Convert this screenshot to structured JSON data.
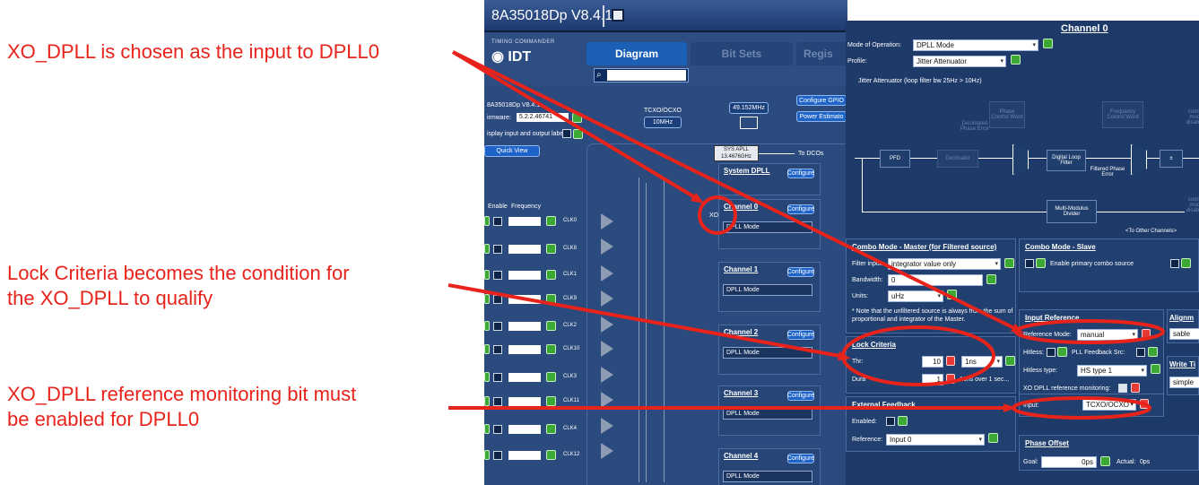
{
  "annotations": [
    {
      "id": "a1",
      "lines": [
        "XO_DPLL is chosen as the input to DPLL0"
      ]
    },
    {
      "id": "a2",
      "lines": [
        "Lock Criteria becomes the condition for",
        "the XO_DPLL to qualify"
      ]
    },
    {
      "id": "a3",
      "lines": [
        "XO_DPLL reference monitoring bit must",
        "be enabled for DPLL0"
      ]
    }
  ],
  "colors": {
    "annotation": "#e8231b",
    "app_bg": "#1f3b6b",
    "accent_blue": "#1e64c8",
    "ok_green": "#3ba933",
    "lock_red": "#e53a35"
  },
  "tc": {
    "window_title": "8A35018Dp V8.4.1",
    "logo_small": "TIMING COMMANDER",
    "logo_big": "IDT",
    "tabs": [
      "Diagram",
      "Bit Sets",
      "Regis"
    ],
    "device_name": "8A35018Dp V8.4.1",
    "firmware_label": "irmware:",
    "firmware_value": "5.2.2.46741",
    "display_labels": "isplay input and output labels",
    "quick_view": "Quick View",
    "tcxo_label": "TCXO/OCXO",
    "tcxo_freq": "10MHz",
    "osc_freq": "49.152MHz",
    "configure_gpio": "Configure GPIO",
    "power_estimator": "Power Estimato",
    "sys_apll": "SYS APLL",
    "sys_apll_freq": "13.4676GHz",
    "to_dcos": "To DCOs",
    "system_dpll": "System DPLL",
    "configure": "Configure",
    "xo_label": "XO",
    "enable_header": "Enable",
    "frequency_header": "Frequency",
    "clocks": [
      "CLK0",
      "CLK8",
      "CLK1",
      "CLK9",
      "CLK2",
      "CLK10",
      "CLK3",
      "CLK11",
      "CLK4",
      "CLK12"
    ],
    "channels": [
      {
        "name": "Channel 0",
        "mode": "DPLL Mode"
      },
      {
        "name": "Channel 1",
        "mode": "DPLL Mode"
      },
      {
        "name": "Channel 2",
        "mode": "DPLL Mode"
      },
      {
        "name": "Channel 3",
        "mode": "DPLL Mode"
      },
      {
        "name": "Channel 4",
        "mode": "DPLL Mode"
      }
    ]
  },
  "ch": {
    "title": "Channel 0",
    "mode_label": "Mode of Operation:",
    "mode_value": "DPLL Mode",
    "profile_label": "Profile:",
    "profile_value": "Jitter Attenuator",
    "profile_desc": "Jitter Attenuator (loop filter bw 25Hz > 10Hz)",
    "blocks": {
      "pfd": "PFD",
      "decimator": "Decimator",
      "decimated_phase_error": "Decimated Phase Error",
      "phase_control_word": "Phase Control Word",
      "digital_loop_filter": "Digital Loop Filter",
      "filtered_phase_error": "Filtered Phase Error",
      "frequency_control_word": "Frequency Control Word",
      "combo_mode_disabled": "combo mode disabled",
      "multi_modulus_divider": "Multi-Modulus Divider",
      "to_other_channels": "<To Other Channels>"
    },
    "combo_master": {
      "title": "Combo Mode - Master (for Filtered source)",
      "filter_input_label": "Filter input:",
      "filter_input_value": "integrator value only",
      "bandwidth_label": "Bandwidth:",
      "bandwidth_value": "0",
      "units_label": "Units:",
      "units_value": "uHz",
      "note": "* Note that the unfiltered source is always from the sum of proportional and integrator of the Master."
    },
    "combo_slave": {
      "title": "Combo Mode - Slave",
      "enable_label": "Enable primary combo source"
    },
    "lock_criteria": {
      "title": "Lock Criteria",
      "row1_label": "Thr:",
      "row1_value": "10",
      "row1_unit": "1ns",
      "row2_label": "Dura",
      "row2_value": "1",
      "row2_text": "10ns over 1 sec..."
    },
    "input_reference": {
      "title": "Input Reference",
      "mode_label": "Reference Mode:",
      "mode_value": "manual",
      "hitless_label": "Hitless:",
      "pll_feedback_label": "PLL Feedback Src:",
      "hitless_type_label": "Hitless type:",
      "hitless_type_value": "HS type 1",
      "xo_monitor_label": "XO DPLL reference monitoring:",
      "input_label": "Input:",
      "input_value": "TCXO/OCXO"
    },
    "alignment": {
      "title": "Alignm",
      "value": "sable"
    },
    "write_t": {
      "title": "Write Ti",
      "value": "simple"
    },
    "external_feedback": {
      "title": "External Feedback",
      "enabled_label": "Enabled:",
      "reference_label": "Reference:",
      "reference_value": "Input 0"
    },
    "phase_offset": {
      "title": "Phase Offset",
      "goal_label": "Goal:",
      "goal_value": "0ps",
      "actual_label": "Actual:",
      "actual_value": "0ps"
    }
  }
}
